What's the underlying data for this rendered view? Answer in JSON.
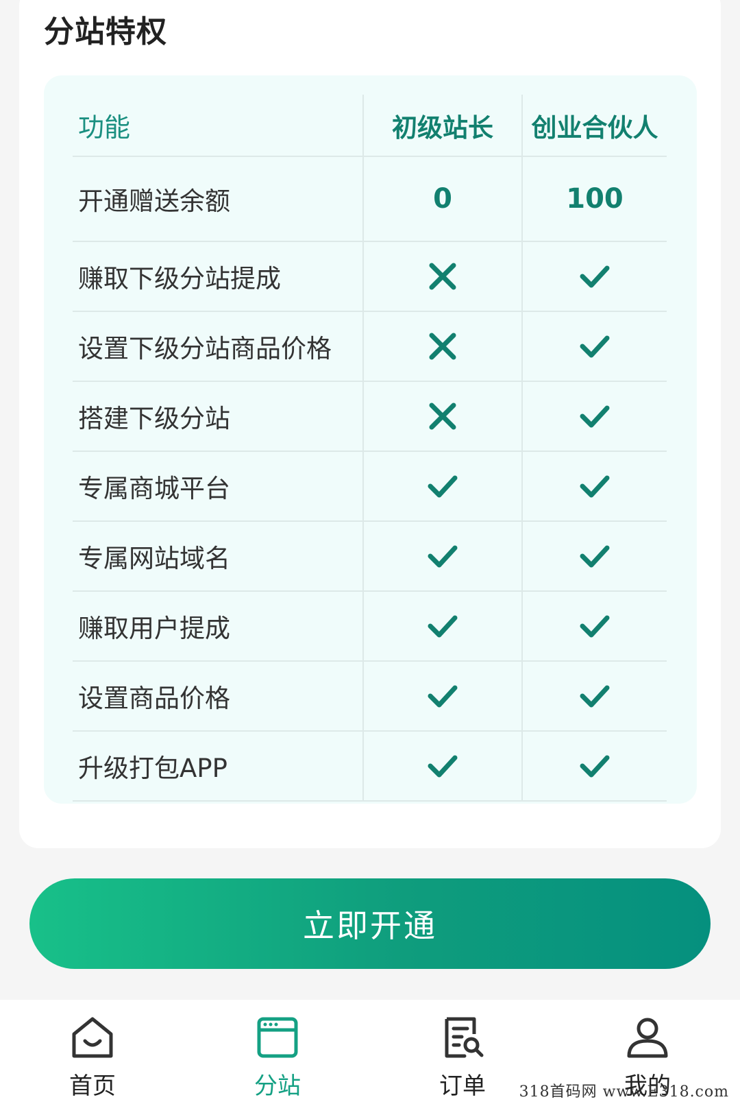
{
  "section": {
    "title": "分站特权"
  },
  "table": {
    "headers": [
      "功能",
      "初级站长",
      "创业合伙人"
    ],
    "rows": [
      {
        "feature": "开通赠送余额",
        "junior": "0",
        "partner": "100"
      },
      {
        "feature": "赚取下级分站提成",
        "junior": "cross",
        "partner": "check"
      },
      {
        "feature": "设置下级分站商品价格",
        "junior": "cross",
        "partner": "check"
      },
      {
        "feature": "搭建下级分站",
        "junior": "cross",
        "partner": "check"
      },
      {
        "feature": "专属商城平台",
        "junior": "check",
        "partner": "check"
      },
      {
        "feature": "专属网站域名",
        "junior": "check",
        "partner": "check"
      },
      {
        "feature": "赚取用户提成",
        "junior": "check",
        "partner": "check"
      },
      {
        "feature": "设置商品价格",
        "junior": "check",
        "partner": "check"
      },
      {
        "feature": "升级打包APP",
        "junior": "check",
        "partner": "check"
      }
    ]
  },
  "cta": {
    "label": "立即开通"
  },
  "nav": {
    "items": [
      {
        "label": "首页",
        "icon": "home-icon",
        "active": false
      },
      {
        "label": "分站",
        "icon": "browser-window-icon",
        "active": true
      },
      {
        "label": "订单",
        "icon": "order-search-icon",
        "active": false
      },
      {
        "label": "我的",
        "icon": "user-icon",
        "active": false
      }
    ]
  },
  "watermark": "318首码网 www.E318.com",
  "colors": {
    "accent": "#12806f",
    "button_start": "#18c089",
    "button_end": "#05907e",
    "nav_active": "#14a083"
  }
}
